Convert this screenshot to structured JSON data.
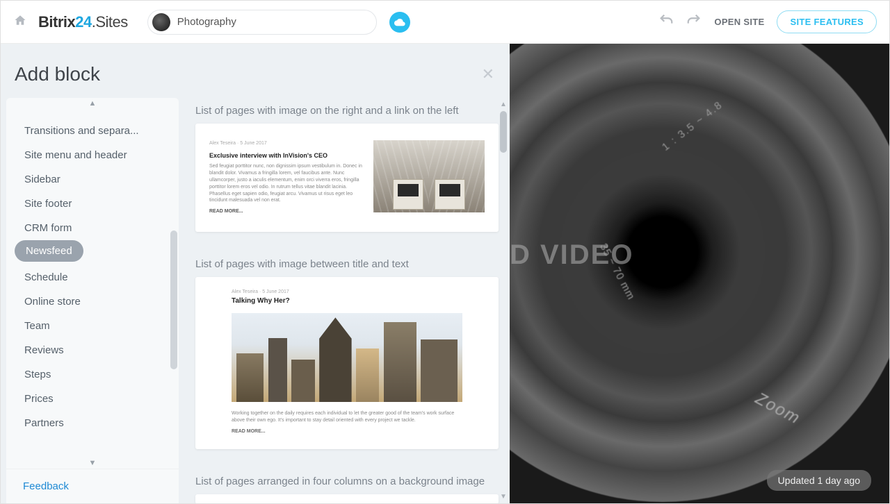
{
  "topbar": {
    "logo_prefix": "Bitrix",
    "logo_num": "24",
    "logo_suffix": ".Sites",
    "site_name": "Photography",
    "open_site": "OPEN SITE",
    "site_features": "SITE FEATURES"
  },
  "panel": {
    "title": "Add block",
    "feedback": "Feedback"
  },
  "categories": [
    "Transitions and separa...",
    "Site menu and header",
    "Sidebar",
    "Site footer",
    "CRM form",
    "Newsfeed",
    "Schedule",
    "Online store",
    "Team",
    "Reviews",
    "Steps",
    "Prices",
    "Partners"
  ],
  "active_category_index": 5,
  "blocks": [
    {
      "title": "List of pages with image on the right and a link on the left",
      "preview": {
        "meta": "Alex Teseira · 5 June 2017",
        "heading": "Exclusive interview with InVision's CEO",
        "body": "Sed feugiat porttitor nunc, non dignissim ipsum vestibulum in. Donec in blandit dolor. Vivamus a fringilla lorem, vel faucibus ante. Nunc ullamcorper, justo a iaculis elementum, enim orci viverra eros, fringilla porttitor lorem eros vel odio. In rutrum tellus vitae blandit lacinia. Phasellus eget sapien odio, feugiat arcu. Vivamus ut risus eget leo tincidunt malesuada vel non erat.",
        "readmore": "READ MORE..."
      }
    },
    {
      "title": "List of pages with image between title and text",
      "preview": {
        "meta": "Alex Teseira · 5 June 2017",
        "heading": "Talking Why Her?",
        "body": "Working together on the daily requires each individual to let the greater good of the team's work surface above their own ego. It's important to stay detail oriented with every project we tackle.",
        "readmore": "READ MORE..."
      }
    },
    {
      "title": "List of pages arranged in four columns on a background image"
    }
  ],
  "preview": {
    "hero_text": "D VIDEO",
    "lens_aperture": "1 : 3.5 ~ 4.8",
    "lens_focal": "35 ~ 70 mm",
    "updated": "Updated 1 day ago"
  }
}
